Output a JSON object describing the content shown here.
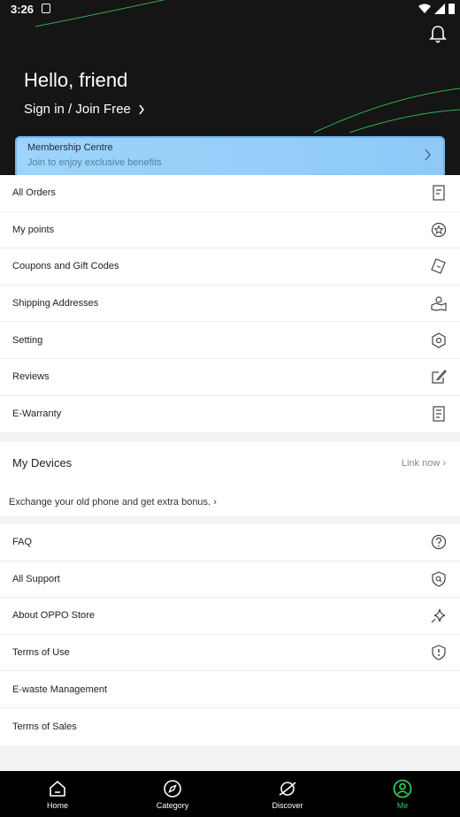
{
  "status": {
    "time": "3:26"
  },
  "header": {
    "greeting": "Hello, friend",
    "signin": "Sign in / Join Free",
    "membership_title": "Membership Centre",
    "membership_subtitle": "Join to enjoy exclusive benefits"
  },
  "menu1": [
    {
      "label": "All Orders",
      "icon": "receipt-icon"
    },
    {
      "label": "My points",
      "icon": "star-circle-icon"
    },
    {
      "label": "Coupons and Gift Codes",
      "icon": "ticket-icon"
    },
    {
      "label": "Shipping Addresses",
      "icon": "map-pin-icon"
    },
    {
      "label": "Setting",
      "icon": "hexagon-settings-icon"
    },
    {
      "label": "Reviews",
      "icon": "edit-icon"
    },
    {
      "label": "E-Warranty",
      "icon": "document-icon"
    }
  ],
  "devices": {
    "title": "My Devices",
    "link": "Link now",
    "exchange": "Exchange your old phone and get extra bonus."
  },
  "menu2": [
    {
      "label": "FAQ",
      "icon": "help-icon"
    },
    {
      "label": "All Support",
      "icon": "support-shield-icon"
    },
    {
      "label": "About OPPO Store",
      "icon": "sparkle-icon"
    },
    {
      "label": "Terms of Use",
      "icon": "shield-icon"
    },
    {
      "label": "E-waste Management",
      "icon": ""
    },
    {
      "label": "Terms of Sales",
      "icon": ""
    }
  ],
  "tabs": [
    {
      "label": "Home",
      "icon": "home-icon"
    },
    {
      "label": "Category",
      "icon": "compass-icon"
    },
    {
      "label": "Discover",
      "icon": "planet-icon"
    },
    {
      "label": "Me",
      "icon": "user-icon"
    }
  ],
  "colors": {
    "active_tab": "#2fc85a",
    "header_bg": "#151515",
    "membership": "#9ed4fb"
  }
}
